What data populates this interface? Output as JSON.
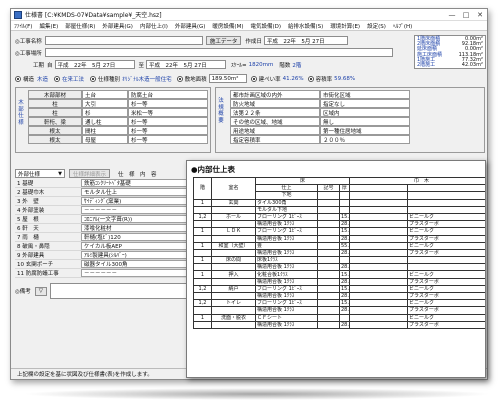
{
  "window": {
    "title": "仕様書 [C:¥KMDS-07¥Data¥sample¥_天空.hsz]",
    "minimize": "—",
    "maximize": "□",
    "close": "✕"
  },
  "menu": [
    "ﾌｧｲﾙ(F)",
    "編集(E)",
    "部屋仕様(R)",
    "外部建具(G)",
    "内部仕上(I)",
    "外部建具(G)",
    "暖房設備(M)",
    "電気設備(D)",
    "給排水設備(S)",
    "環境計算(E)",
    "設定(S)",
    "ﾍﾙﾌﾟ(H)"
  ],
  "header": {
    "project_label": "◎工事名称",
    "project_value": "",
    "place_label": "◎工事場所",
    "place_value": "",
    "construction_btn": "施工データ",
    "created_label": "作成日",
    "created_value": "平成　22年　5月 27日",
    "period_label": "工期",
    "period_from_label": "自",
    "period_from": "平成　22年　5月 27日",
    "period_to_label": "至",
    "period_to": "平成　22年　5月 27日",
    "scale_label": "ｽｹｰﾙ=",
    "scale_value": "1820mm",
    "floors_label": "階数",
    "floors_value": "2階",
    "structure_label": "構造",
    "structure_value": "木造",
    "construction_method": "在来工法",
    "spec_label": "仕様種別",
    "spec_value": "ｵﾘｼﾞﾅﾙ木造一般住宅",
    "site_area_label": "敷地面積",
    "site_area_value": "189.50m²",
    "coverage_label": "建ぺい率",
    "coverage_value": "41.26%",
    "far_label": "容積率",
    "far_value": "59.68%"
  },
  "stats": [
    [
      "1階床面積",
      "0.00m²"
    ],
    [
      "2階床面積",
      "92.18m²"
    ],
    [
      "延床面積",
      "0.00m²"
    ],
    [
      "施工床面積",
      "113.18m²"
    ],
    [
      "1階施工",
      "77.32m²"
    ],
    [
      "2階施工",
      "42.03m²"
    ]
  ],
  "structure_table": {
    "side_label": "木部仕様",
    "headers": [
      "木部部材",
      "寸法",
      "樹種"
    ],
    "rows": [
      [
        "木部部材",
        "土台",
        "防腐土台"
      ],
      [
        "柱",
        "大引",
        "杉一等"
      ],
      [
        "柱",
        "杉",
        "米松一等"
      ],
      [
        "軒桁、梁",
        "通し柱",
        "杉一等"
      ],
      [
        "根太",
        "間柱",
        "杉一等"
      ],
      [
        "根太",
        "母屋",
        "杉一等"
      ]
    ]
  },
  "law_table": {
    "side_label": "法規概要",
    "rows": [
      [
        "都市計画区域の内外",
        "市街化区域"
      ],
      [
        "防火地域",
        "指定なし"
      ],
      [
        "法第２２条",
        "区域内"
      ],
      [
        "その他の区域、地域",
        "無し"
      ],
      [
        "用途地域",
        "第一種住居地域"
      ],
      [
        "指定容積率",
        "２００％"
      ]
    ]
  },
  "lower": {
    "dropdown": "外部仕様",
    "copy_btn": "仕様詳細表示",
    "col_label": "仕　様　内　容",
    "rows": [
      [
        "1 基礎",
        "鉄筋ｺﾝｸﾘｰﾄﾍﾞﾀ基礎"
      ],
      [
        "2 基礎巾木",
        "モルタル仕上"
      ],
      [
        "3 外　壁",
        "ｻｲﾃﾞｨﾝｸﾞ(窯業)"
      ],
      [
        "4 外部塗装",
        "－－－－－－"
      ],
      [
        "5 屋　根",
        "ｺﾛﾆｱﾙ(一文字葺(R))"
      ],
      [
        "6 軒　天",
        "漆喰化粧材"
      ],
      [
        "7 雨　樋",
        "軒樋(塩ﾋﾞ)120"
      ],
      [
        "8 破風・鼻隠",
        "ケイカル板AEP"
      ],
      [
        "9 外部建具",
        "ｱﾙﾐ製建具(ｼﾙﾊﾞｰ)"
      ],
      [
        "10 玄関ポーチ",
        "磁器タイル300角"
      ],
      [
        "11 防腐防蟻工事",
        "－－－－－－"
      ]
    ],
    "remarks_label": "◎備考",
    "remarks_btn": "▽"
  },
  "status": "上記欄の設定を基に状図及び仕様書(表)を作成します。",
  "report": {
    "title": "●内部仕上表",
    "headers": {
      "floor": "階",
      "room": "室名",
      "floor_col": "床",
      "baseboard": "巾　木",
      "finish": "仕上",
      "code": "記号",
      "thickness": "厚",
      "base": "下地"
    },
    "rows": [
      [
        "",
        "",
        "",
        "",
        ""
      ],
      [
        "1",
        "玄関",
        "タイル300角",
        "",
        ""
      ],
      [
        "",
        "",
        "モルタル下地",
        "",
        ""
      ],
      [
        "1,2",
        "ホール",
        "フローリング 1ﾋﾟｰｽ",
        "",
        "15.0"
      ],
      [
        "",
        "",
        "構造用合板 1ｸﾗｽ",
        "",
        "28.0"
      ],
      [
        "1",
        "ＬＤＫ",
        "フローリング 1ﾋﾟｰｽ",
        "",
        "15.0"
      ],
      [
        "",
        "",
        "構造用合板 1ｸﾗｽ",
        "",
        "28.0"
      ],
      [
        "1",
        "和室（大壁）",
        "畳",
        "",
        "55.0"
      ],
      [
        "",
        "",
        "構造用合板 1ｸﾗｽ",
        "",
        "28.0"
      ],
      [
        "1",
        "床の間",
        "床板1ｸﾗｽ",
        "",
        ""
      ],
      [
        "",
        "",
        "構造用合板 1ｸﾗｽ",
        "",
        "28.0"
      ],
      [
        "1",
        "押入",
        "化粧合板1ｸﾗｽ",
        "",
        "15.0"
      ],
      [
        "",
        "",
        "構造用合板 1ｸﾗｽ",
        "",
        "28.0"
      ],
      [
        "1,2",
        "納戸",
        "フローリング 1ﾋﾟｰｽ",
        "",
        "15.0"
      ],
      [
        "",
        "",
        "構造用合板 1ｸﾗｽ",
        "",
        "28.0"
      ],
      [
        "1,2",
        "トイレ",
        "フローリング 1ﾋﾟｰｽ",
        "",
        "15.0"
      ],
      [
        "",
        "",
        "構造用合板 1ｸﾗｽ",
        "",
        "28.0"
      ],
      [
        "1",
        "洗面・脱衣",
        "ＣＦシート",
        "",
        ""
      ],
      [
        "",
        "",
        "構造用合板 1ｸﾗｽ",
        "",
        "28.0"
      ]
    ],
    "right_col": [
      "",
      "",
      "",
      "ビニールク",
      "プラスターボ",
      "ビニールク",
      "プラスターボ",
      "ビニールク",
      "プラスターボ",
      "",
      "",
      "ビニールク",
      "プラスターボ",
      "ビニールク",
      "プラスターボ",
      "ビニールク",
      "プラスターボ",
      "ビニールク",
      "プラスターボ"
    ]
  }
}
